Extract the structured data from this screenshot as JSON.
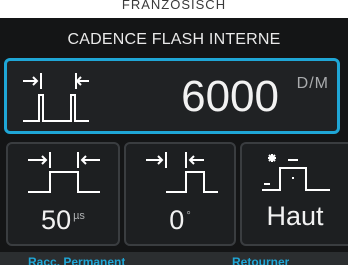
{
  "caption": "FRANZÖSISCH",
  "screen": {
    "title": "CADENCE FLASH INTERNE",
    "rate": {
      "value": "6000",
      "unit": "D/M",
      "icon": "pulse-interval-icon"
    },
    "params": [
      {
        "value": "50",
        "unit": "µs",
        "icon": "pulse-width-icon"
      },
      {
        "value": "0",
        "unit": "°",
        "icon": "pulse-delay-icon"
      },
      {
        "value": "Haut",
        "unit": "",
        "icon": "pulse-edge-icon"
      }
    ],
    "buttons": {
      "left": "Racc. Permanent",
      "right": "Retourner"
    }
  },
  "colors": {
    "accent": "#1fa6d6",
    "screen_bg": "#141516",
    "panel_bg": "#1d1f21",
    "text": "#f2f2f2"
  }
}
